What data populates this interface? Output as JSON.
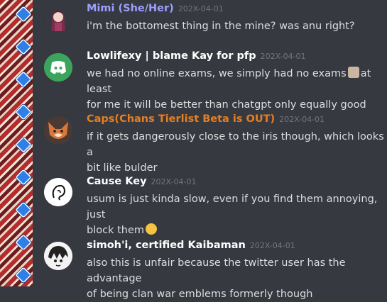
{
  "messages": [
    {
      "author": "Mimi (She/Her)",
      "author_color": "#9d9ffd",
      "timestamp": "202X-04-01",
      "lines": [
        "i'm the bottomest thing in the mine? was anu right?"
      ],
      "avatar": "anime-girl-avatar"
    },
    {
      "author": "Lowlifexy | blame Kay for pfp",
      "author_color": "#ffffff",
      "timestamp": "202X-04-01",
      "lines": [
        "we had no online exams, we simply had no exams",
        "at least",
        "for me it will be better than chatgpt only equally good"
      ],
      "avatar": "discord-default-avatar"
    },
    {
      "author": "Caps(Chans Tierlist Beta is OUT)",
      "author_color": "#e67e22",
      "timestamp": "202X-04-01",
      "lines": [
        "if it gets dangerously close to the iris though, which looks a",
        "bit like bulder"
      ],
      "avatar": "fox-avatar"
    },
    {
      "author": "Cause Key",
      "author_color": "#ffffff",
      "timestamp": "202X-04-01",
      "lines": [
        "usum is just kinda slow, even if you find them annoying, just",
        "block them"
      ],
      "avatar": "ear-sketch-avatar"
    },
    {
      "author": "simoh'i, certified Kaibaman",
      "author_color": "#ffffff",
      "timestamp": "202X-04-01",
      "lines": [
        "also this is unfair because the twitter user has the advantage",
        "of being clan war emblems formerly though"
      ],
      "avatar": "manga-avatar"
    }
  ]
}
